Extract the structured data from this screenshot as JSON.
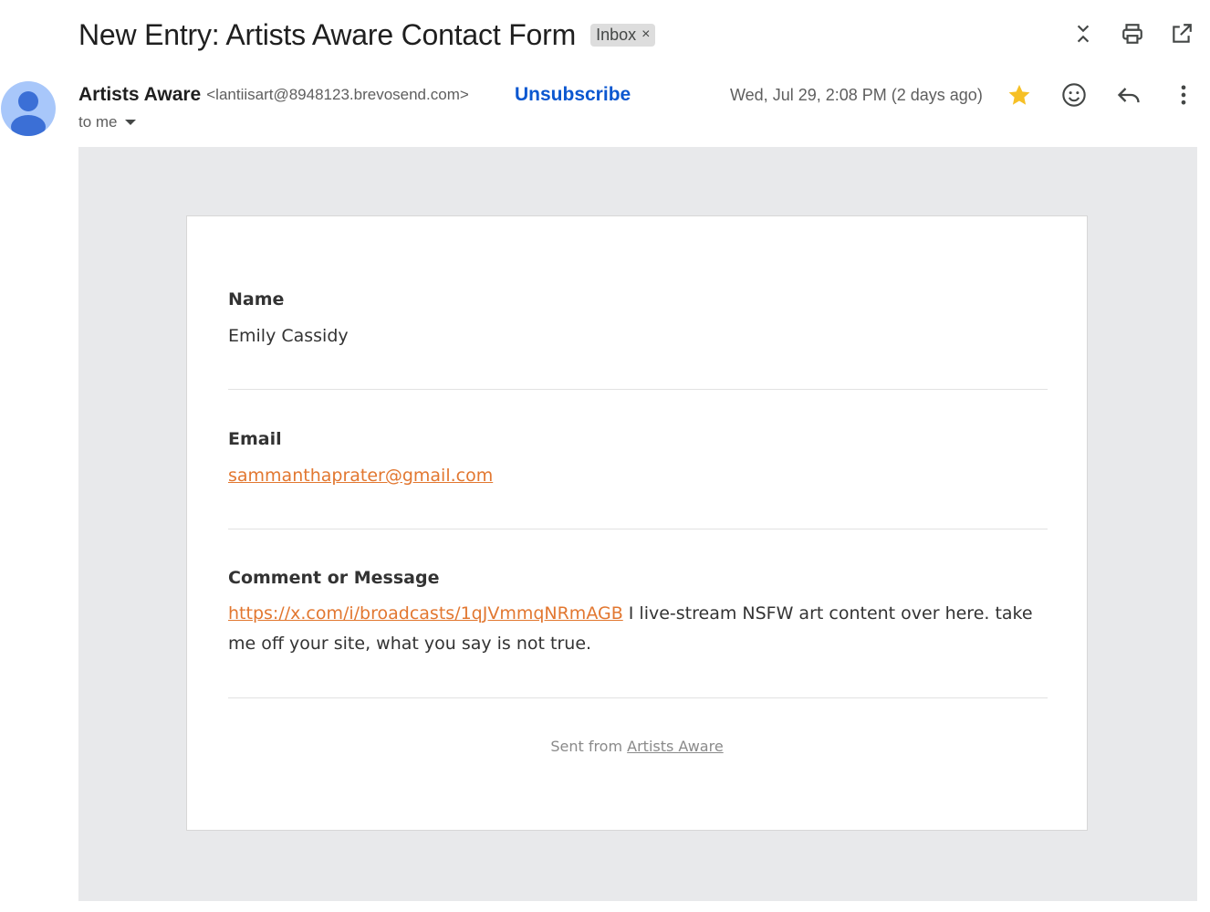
{
  "header": {
    "subject": "New Entry: Artists Aware Contact Form",
    "label": "Inbox",
    "label_remove": "×"
  },
  "toolbar_icons": [
    "expand-collapse-icon",
    "print-icon",
    "open-in-new-window-icon"
  ],
  "sender": {
    "name": "Artists Aware",
    "email": "<lantiisart@8948123.brevosend.com>",
    "unsubscribe": "Unsubscribe",
    "date": "Wed, Jul 29, 2:08 PM (2 days ago)",
    "recipient": "to me",
    "starred": true
  },
  "message_icons": [
    "star-icon",
    "emoji-reaction-icon",
    "reply-icon",
    "more-options-icon"
  ],
  "form": {
    "name_label": "Name",
    "name_value": "Emily Cassidy",
    "email_label": "Email",
    "email_value": "sammanthaprater@gmail.com",
    "message_label": "Comment or Message",
    "message_link": "https://x.com/i/broadcasts/1qJVmmqNRmAGB",
    "message_text": " I live-stream NSFW art content over here. take me off your site, what you say is not true."
  },
  "footer": {
    "prefix": "Sent from ",
    "link": "Artists Aware"
  },
  "colors": {
    "accent_link": "#e27730",
    "unsubscribe": "#0b57d0",
    "star": "#f6c026",
    "avatar": "#a8c7fa"
  }
}
